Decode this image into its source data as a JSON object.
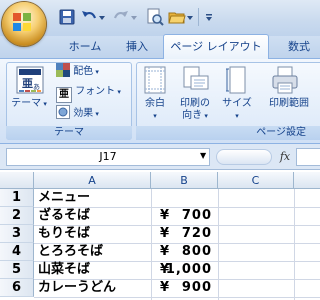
{
  "quick_access": {
    "icons": [
      "save-icon",
      "undo-icon",
      "redo-icon",
      "print-preview-icon",
      "open-folder-icon",
      "customize-icon"
    ]
  },
  "tabs": [
    {
      "label": "ホーム"
    },
    {
      "label": "挿入"
    },
    {
      "label": "ページ レイアウト",
      "active": true
    },
    {
      "label": "数式"
    }
  ],
  "ribbon": {
    "theme_group": {
      "label": "テーマ",
      "theme_button": "テーマ",
      "colors": "配色",
      "fonts": "フォント",
      "effects": "効果"
    },
    "page_setup_group": {
      "label": "ページ設定",
      "margins": "余白",
      "orientation_line1": "印刷の",
      "orientation_line2": "向き",
      "size": "サイズ",
      "print_area": "印刷範囲"
    }
  },
  "formula_bar": {
    "name_box": "J17",
    "fx": "fx",
    "formula": ""
  },
  "grid": {
    "columns": [
      "A",
      "B",
      "C"
    ],
    "rows": [
      {
        "num": "1",
        "a": "メニュー",
        "b_yen": "",
        "b_num": ""
      },
      {
        "num": "2",
        "a": "ざるそば",
        "b_yen": "¥",
        "b_num": "700"
      },
      {
        "num": "3",
        "a": "もりそば",
        "b_yen": "¥",
        "b_num": "720"
      },
      {
        "num": "4",
        "a": "とろろそば",
        "b_yen": "¥",
        "b_num": "800"
      },
      {
        "num": "5",
        "a": "山菜そば",
        "b_yen": "¥",
        "b_num": "1,000"
      },
      {
        "num": "6",
        "a": "カレーうどん",
        "b_yen": "¥",
        "b_num": "900"
      }
    ]
  },
  "colors": {
    "ribbon_text": "#15428b",
    "ribbon_border": "#8db2e3",
    "header_border": "#9eb6ce"
  }
}
